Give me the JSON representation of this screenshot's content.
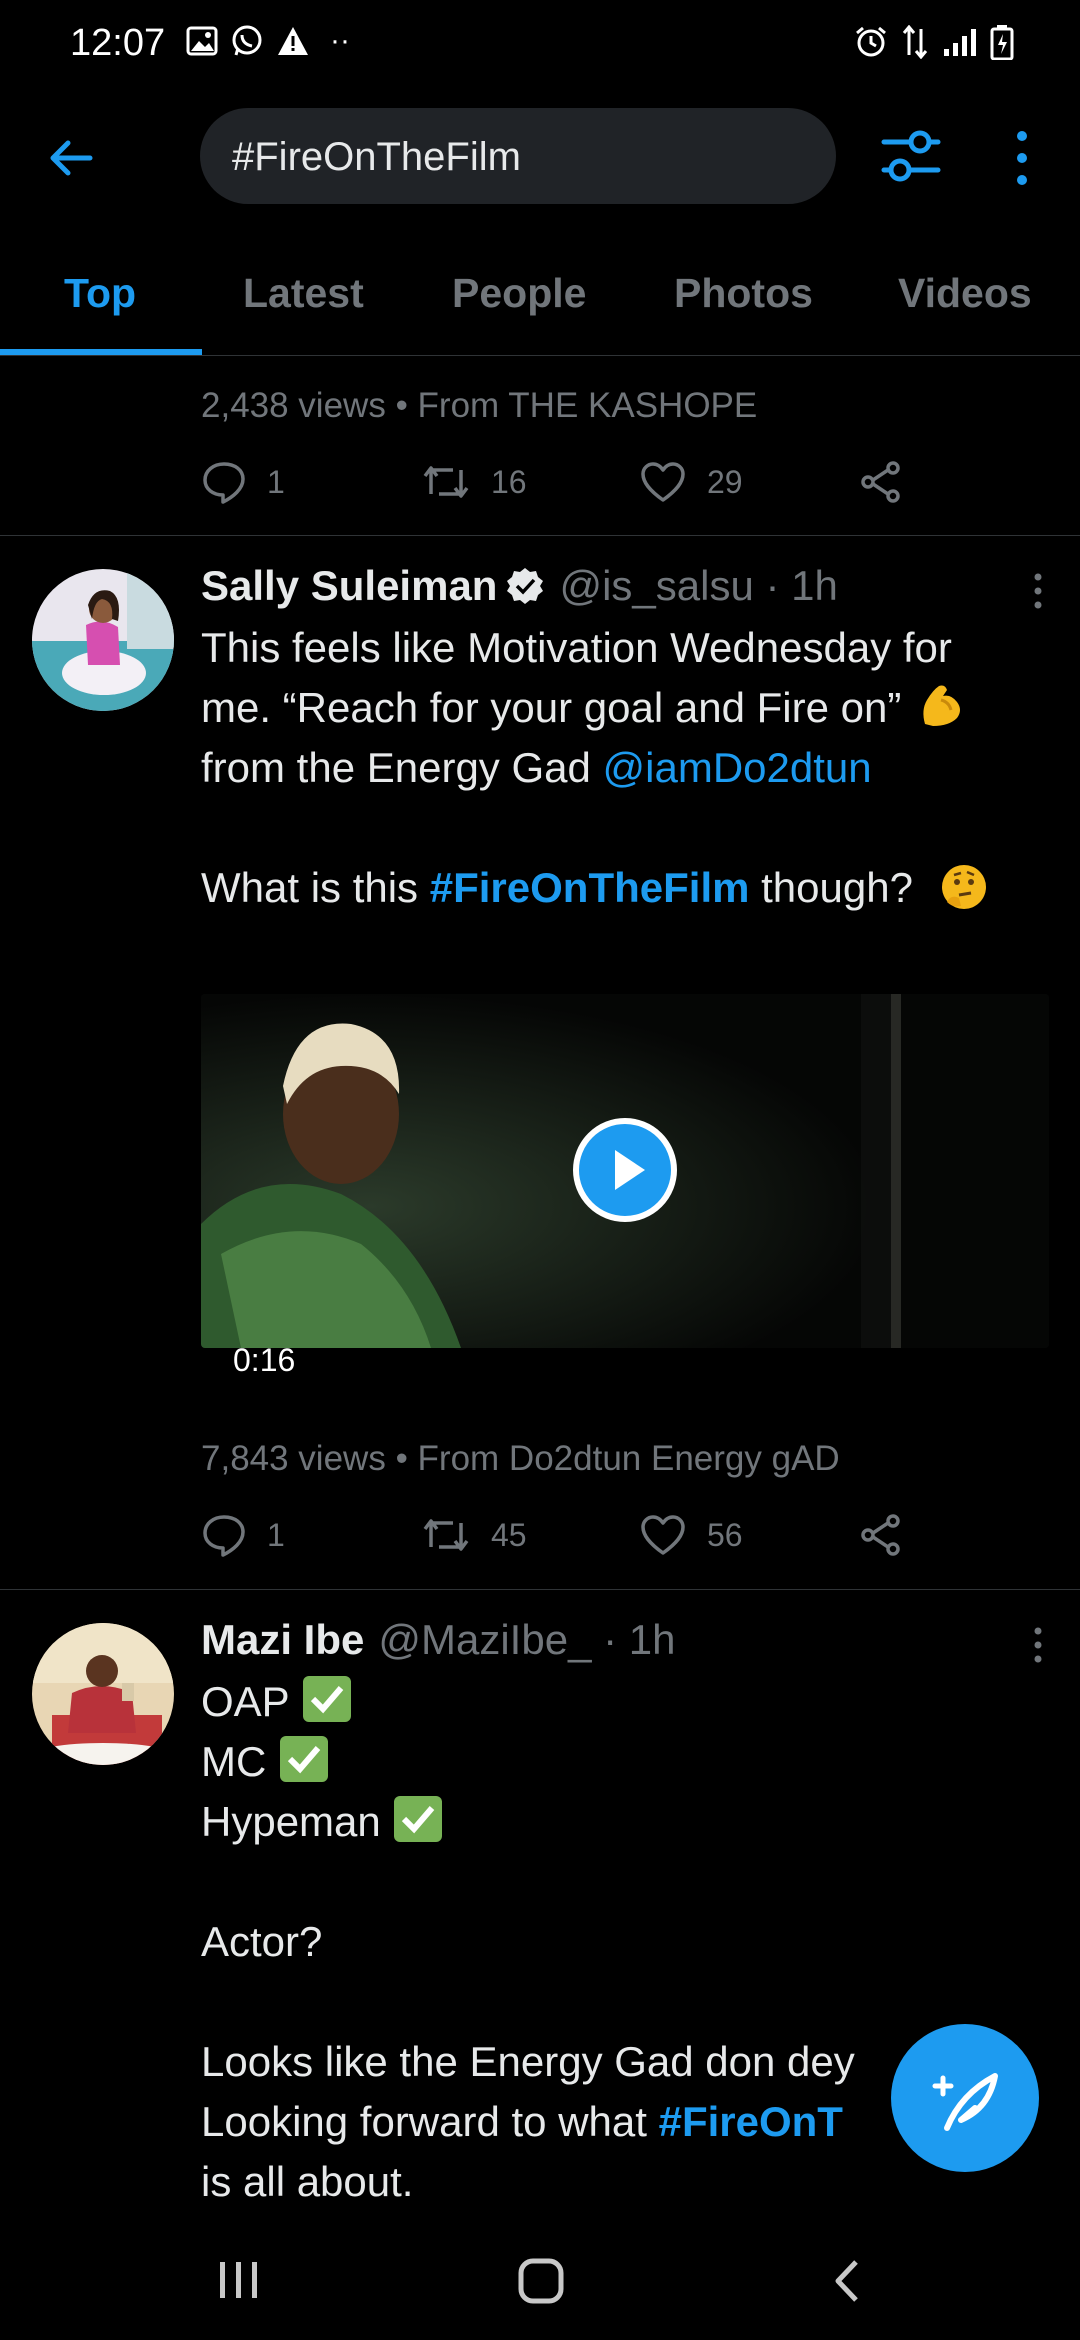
{
  "status_bar": {
    "time": "12:07"
  },
  "search": {
    "query": "#FireOnTheFilm"
  },
  "tabs": [
    {
      "label": "Top",
      "active": true
    },
    {
      "label": "Latest",
      "active": false
    },
    {
      "label": "People",
      "active": false
    },
    {
      "label": "Photos",
      "active": false
    },
    {
      "label": "Videos",
      "active": false
    }
  ],
  "tweet0": {
    "views": "2,438 views",
    "from": "From THE KASHOPE",
    "replies": "1",
    "retweets": "16",
    "likes": "29"
  },
  "tweet1": {
    "name": "Sally Suleiman",
    "handle": "@is_salsu · 1h",
    "verified": true,
    "line1": "This feels like Motivation Wednesday for",
    "line2": "me. “Reach for your goal and Fire on”",
    "line3_text": "from the Energy Gad ",
    "line3_link": "@iamDo2dtun",
    "line5_pre": "What is this ",
    "line5_hashtag": "#FireOnTheFilm",
    "line5_post": " though?",
    "video_duration": "0:16",
    "views": "7,843 views",
    "from": "From Do2dtun Energy gAD",
    "replies": "1",
    "retweets": "45",
    "likes": "56"
  },
  "tweet2": {
    "name": "Mazi Ibe",
    "handle": "@MaziIbe_ · 1h",
    "line1": "OAP ",
    "line2": "MC",
    "line3": "Hypeman ",
    "line5": "Actor?",
    "line7": "Looks like the Energy Gad don dey",
    "line8_pre": "Looking forward to what ",
    "line8_hashtag": "#FireOnT",
    "line9": "is all about."
  },
  "colors": {
    "accent": "#1d9bf0",
    "muted": "#71767b",
    "background": "#000000"
  }
}
